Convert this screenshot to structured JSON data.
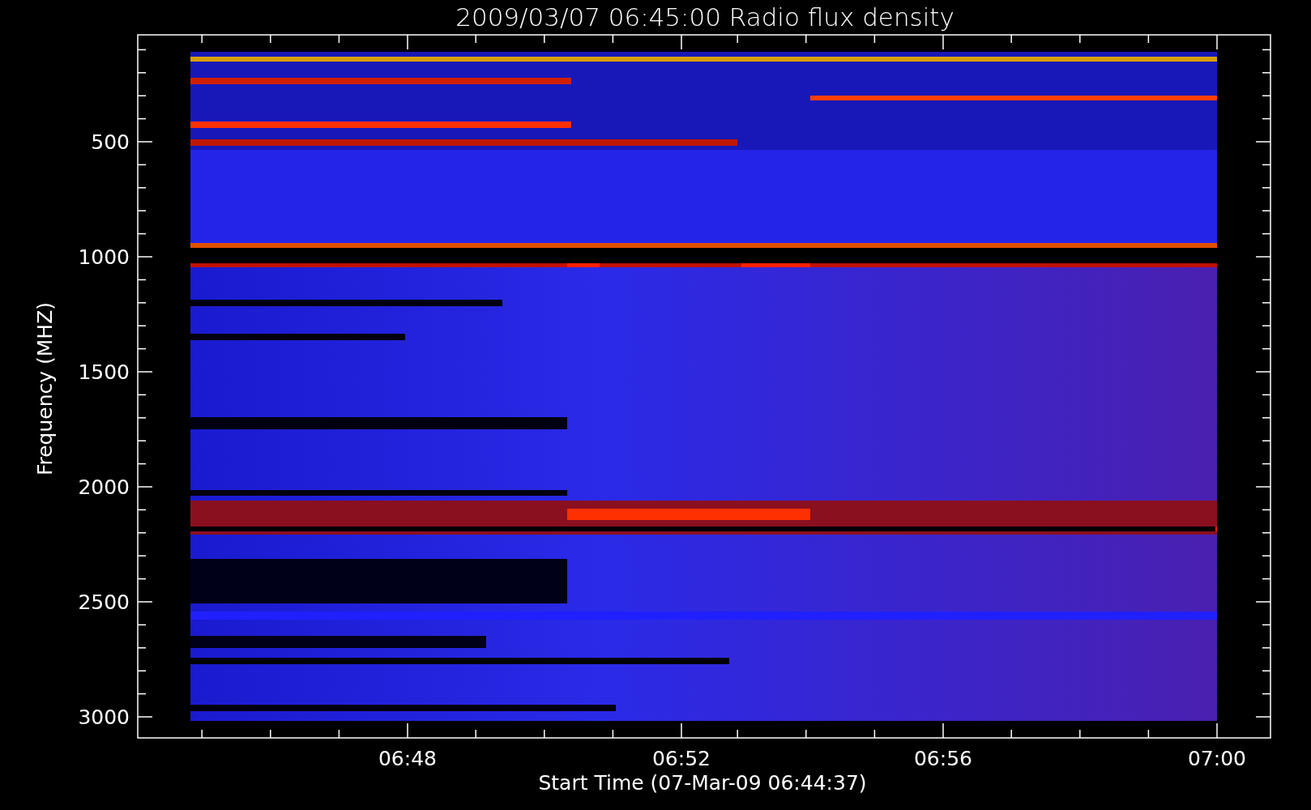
{
  "title": "2009/03/07 06:45:00 Radio flux density",
  "y_axis": {
    "label": "Frequency (MHZ)",
    "ticks": [
      "500",
      "1000",
      "1500",
      "2000",
      "2500",
      "3000"
    ]
  },
  "x_axis": {
    "label": "Start Time (07-Mar-09 06:44:37)",
    "ticks": [
      "06:48",
      "06:52",
      "06:56",
      "07:00"
    ]
  }
}
